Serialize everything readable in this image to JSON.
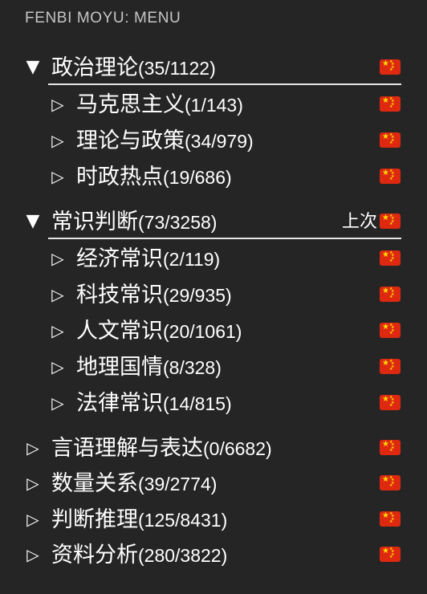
{
  "header": {
    "title": "FENBI MOYU: MENU"
  },
  "icons": {
    "expanded": "▼",
    "collapsed": "▷",
    "flag": "china-flag-icon"
  },
  "colors": {
    "background": "#252526",
    "text": "#ffffff",
    "header_text": "#c6c6c6",
    "divider": "#e6e6e6",
    "flag_red": "#de2910",
    "flag_star": "#ffde00"
  },
  "tree": [
    {
      "level": 0,
      "expanded": true,
      "name": "政治理论",
      "count": "(35/1122)",
      "last": ""
    },
    {
      "level": 1,
      "expanded": false,
      "name": "马克思主义",
      "count": "(1/143)",
      "last": ""
    },
    {
      "level": 1,
      "expanded": false,
      "name": "理论与政策",
      "count": "(34/979)",
      "last": ""
    },
    {
      "level": 1,
      "expanded": false,
      "name": "时政热点",
      "count": "(19/686)",
      "last": ""
    },
    {
      "level": 0,
      "expanded": true,
      "name": "常识判断",
      "count": "(73/3258)",
      "last": "上次"
    },
    {
      "level": 1,
      "expanded": false,
      "name": "经济常识",
      "count": "(2/119)",
      "last": ""
    },
    {
      "level": 1,
      "expanded": false,
      "name": "科技常识",
      "count": "(29/935)",
      "last": ""
    },
    {
      "level": 1,
      "expanded": false,
      "name": "人文常识",
      "count": "(20/1061)",
      "last": ""
    },
    {
      "level": 1,
      "expanded": false,
      "name": "地理国情",
      "count": "(8/328)",
      "last": ""
    },
    {
      "level": 1,
      "expanded": false,
      "name": "法律常识",
      "count": "(14/815)",
      "last": ""
    },
    {
      "level": 0,
      "expanded": false,
      "name": "言语理解与表达",
      "count": "(0/6682)",
      "last": ""
    },
    {
      "level": 0,
      "expanded": false,
      "name": "数量关系",
      "count": "(39/2774)",
      "last": ""
    },
    {
      "level": 0,
      "expanded": false,
      "name": "判断推理",
      "count": "(125/8431)",
      "last": ""
    },
    {
      "level": 0,
      "expanded": false,
      "name": "资料分析",
      "count": "(280/3822)",
      "last": ""
    }
  ]
}
